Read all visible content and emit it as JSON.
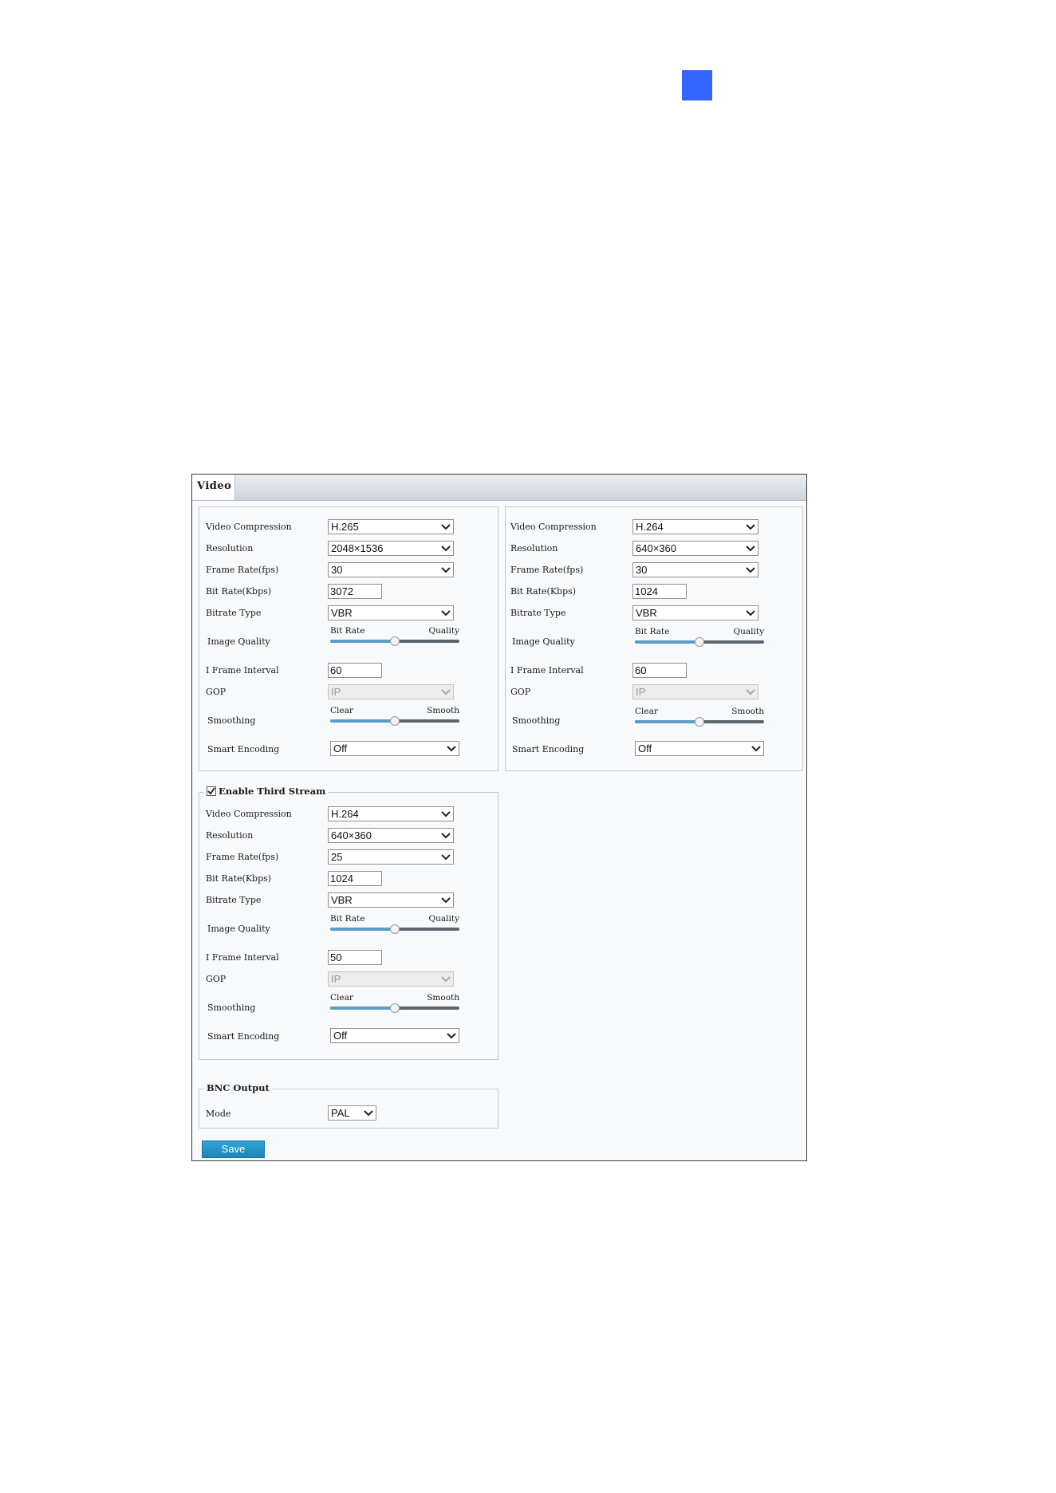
{
  "page_marker": {
    "color": "#3366ff"
  },
  "tab": {
    "label": "Video"
  },
  "labels": {
    "video_compression": "Video Compression",
    "resolution": "Resolution",
    "frame_rate": "Frame Rate(fps)",
    "bit_rate": "Bit Rate(Kbps)",
    "bitrate_type": "Bitrate Type",
    "image_quality": "Image Quality",
    "i_frame_interval": "I Frame Interval",
    "gop": "GOP",
    "smoothing": "Smoothing",
    "smart_encoding": "Smart Encoding"
  },
  "main_stream": {
    "video_compression": "H.265",
    "resolution": "2048×1536",
    "frame_rate": "30",
    "bit_rate": "3072",
    "bitrate_type": "VBR",
    "image_quality": {
      "left_label": "Bit Rate",
      "right_label": "Quality",
      "level": 0.5
    },
    "i_frame_interval": "60",
    "gop": "IP",
    "smoothing": {
      "left_label": "Clear",
      "right_label": "Smooth",
      "level": 0.5
    },
    "smart_encoding": "Off"
  },
  "sub_stream": {
    "video_compression": "H.264",
    "resolution": "640×360",
    "frame_rate": "30",
    "bit_rate": "1024",
    "bitrate_type": "VBR",
    "image_quality": {
      "left_label": "Bit Rate",
      "right_label": "Quality",
      "level": 0.5
    },
    "i_frame_interval": "60",
    "gop": "IP",
    "smoothing": {
      "left_label": "Clear",
      "right_label": "Smooth",
      "level": 0.5
    },
    "smart_encoding": "Off"
  },
  "third_stream": {
    "enable_label": "Enable Third Stream",
    "enabled": true,
    "video_compression": "H.264",
    "resolution": "640×360",
    "frame_rate": "25",
    "bit_rate": "1024",
    "bitrate_type": "VBR",
    "image_quality": {
      "left_label": "Bit Rate",
      "right_label": "Quality",
      "level": 0.5
    },
    "i_frame_interval": "50",
    "gop": "IP",
    "smoothing": {
      "left_label": "Clear",
      "right_label": "Smooth",
      "level": 0.5
    },
    "smart_encoding": "Off"
  },
  "bnc_output": {
    "title": "BNC Output",
    "mode_label": "Mode",
    "mode": "PAL"
  },
  "save_button": {
    "label": "Save"
  },
  "colors": {
    "accent": "#2196cf",
    "slider_fill": "#5b9dc6",
    "slider_track": "#5a6570"
  }
}
